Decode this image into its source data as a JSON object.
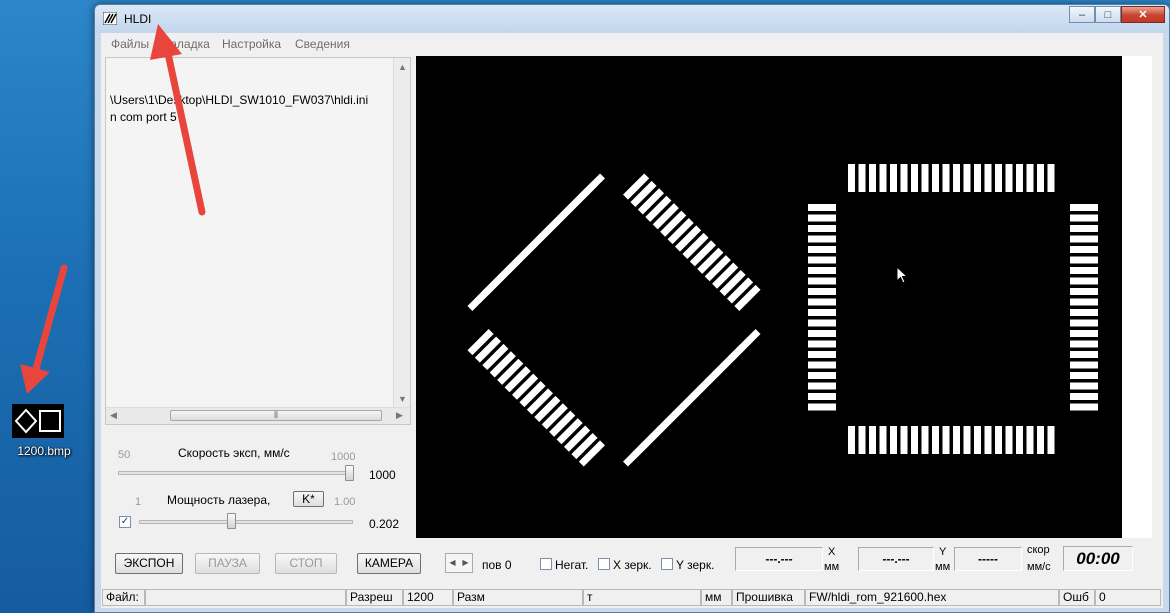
{
  "desktop": {
    "icon_label": "1200.bmp"
  },
  "window": {
    "title": "HLDI",
    "buttons": [
      "–",
      "□",
      "✕"
    ]
  },
  "menu": [
    "Файлы",
    "Заладка",
    "Настройка",
    "Сведения"
  ],
  "log": {
    "lines": [
      "\\Users\\1\\Desktop\\HLDI_SW1010_FW037\\hldi.ini",
      "n com port 5"
    ]
  },
  "exposure": {
    "label": "Скорость эксп, мм/с",
    "min": "50",
    "max": "1000",
    "value": "1000",
    "level": 1.0
  },
  "laser": {
    "label": "Мощность лазера,",
    "k_button": "K*",
    "min": "1",
    "max": "1.00",
    "value": "0.202",
    "level": 0.43,
    "checked": true
  },
  "buttons": {
    "expon": "ЭКСПОН",
    "pause": "ПАУЗА",
    "stop": "СТОП",
    "camera": "КАМЕРА"
  },
  "rotation": {
    "label": "пов",
    "value": "0"
  },
  "checks": {
    "negative": "Негат.",
    "x_mirror": "X зерк.",
    "y_mirror": "Y зерк."
  },
  "readouts": {
    "x_value": "---.---",
    "x_label": "X",
    "x_unit": "мм",
    "y_value": "---.---",
    "y_label": "Y",
    "y_unit": "мм",
    "speed_value": "-----",
    "speed_label": "скор",
    "speed_unit": "мм/с",
    "time": "00:00"
  },
  "status": {
    "file_label": "Файл:",
    "file_value": "",
    "res_label": "Разреш",
    "res_value": "1200",
    "size_label": "Разм",
    "size_value": "",
    "t_label": "т",
    "mm_label": "мм",
    "fw_label": "Прошивка",
    "fw_value": "FW/hldi_rom_921600.hex",
    "err_label": "Ошб",
    "err_value": "0"
  },
  "colors": {
    "background": "#000000",
    "pads": "#ffffff",
    "arrow": "#e8453c"
  }
}
